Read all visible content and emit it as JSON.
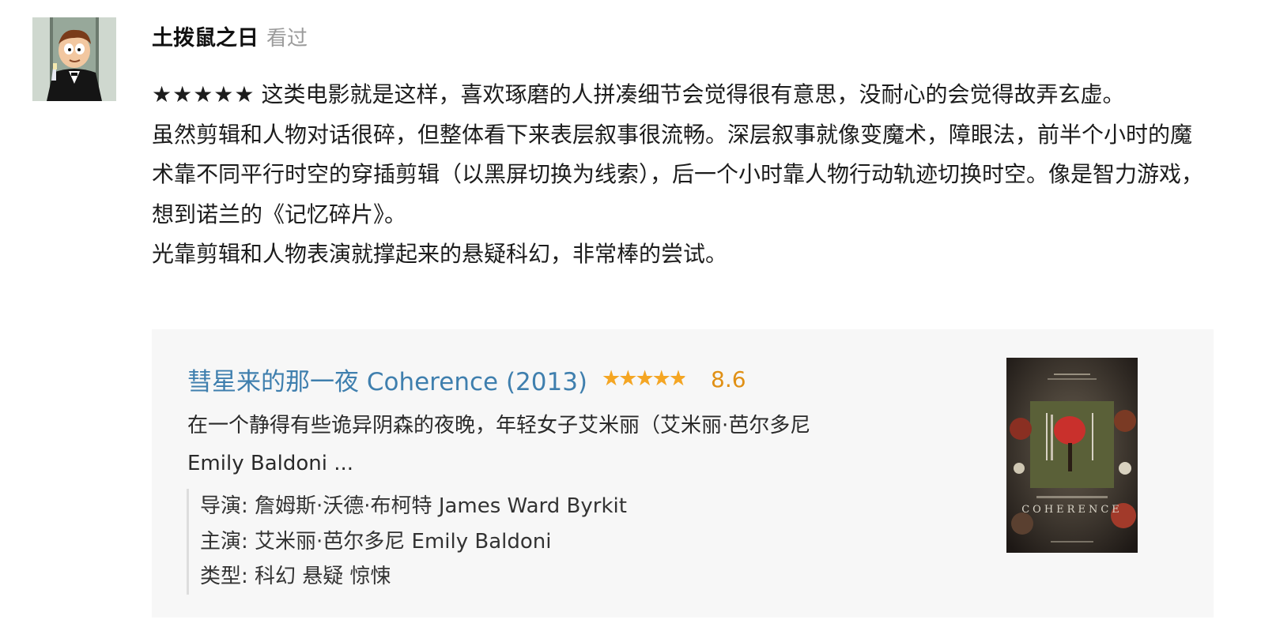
{
  "review": {
    "username": "土拨鼠之日",
    "status": "看过",
    "stars": "★★★★★",
    "paragraphs": [
      "这类电影就是这样，喜欢琢磨的人拼凑细节会觉得很有意思，没耐心的会觉得故弄玄虚。",
      "虽然剪辑和人物对话很碎，但整体看下来表层叙事很流畅。深层叙事就像变魔术，障眼法，前半个小时的魔术靠不同平行时空的穿插剪辑（以黑屏切换为线索），后一个小时靠人物行动轨迹切换时空。像是智力游戏，想到诺兰的《记忆碎片》。",
      "光靠剪辑和人物表演就撑起来的悬疑科幻，非常棒的尝试。"
    ]
  },
  "movie": {
    "title": "彗星来的那一夜 Coherence (2013)",
    "rating_value": 8.6,
    "rating_stars_fraction": 0.86,
    "rating_label": "8.6",
    "synopsis_line1": "在一个静得有些诡异阴森的夜晚，年轻女子艾米丽（艾米丽·芭尔多尼",
    "synopsis_line2": "Emily Baldoni ...",
    "director": "导演: 詹姆斯·沃德·布柯特 James Ward Byrkit",
    "cast": "主演: 艾米丽·芭尔多尼 Emily Baldoni",
    "genre": "类型: 科幻 悬疑 惊悚",
    "poster_text": "COHERENCE"
  },
  "colors": {
    "link": "#3f7fae",
    "rating_star": "#f5a623",
    "rating_score": "#e09015",
    "muted": "#9b9b9b",
    "card_bg": "#f7f7f7"
  },
  "icons": {
    "avatar": "cartoon-avatar",
    "poster": "movie-poster"
  }
}
